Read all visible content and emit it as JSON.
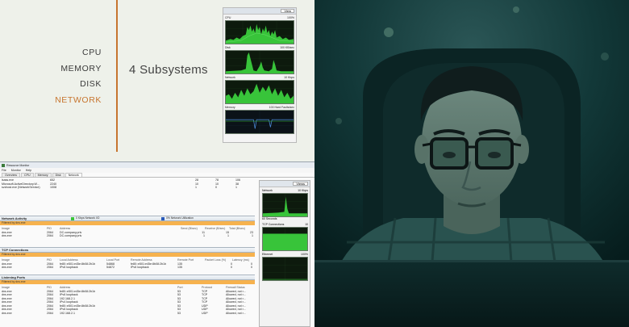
{
  "slide": {
    "subsystems": [
      "CPU",
      "MEMORY",
      "DISK",
      "NETWORK"
    ],
    "active_subsystem": "NETWORK",
    "title": "4 Subsystems",
    "accent_color": "#c7752f",
    "mini_panel": {
      "view_label": "View",
      "graphs": [
        {
          "name": "CPU",
          "value": "100%"
        },
        {
          "name": "Disk",
          "value": "100 KB/sec"
        },
        {
          "name": "Network",
          "value": "10 Kbps"
        },
        {
          "name": "Memory",
          "value": "100 Hard Faults/sec"
        }
      ]
    }
  },
  "resource_monitor": {
    "title": "Resource Monitor",
    "menu": [
      "File",
      "Monitor",
      "Help"
    ],
    "tabs": [
      "Overview",
      "CPU",
      "Memory",
      "Disk",
      "Network"
    ],
    "active_tab": "Network",
    "process_rows": [
      [
        "lsass.exe",
        "652",
        "28",
        "78",
        "106"
      ],
      [
        "Microsoft.ActiveDirectory.W...",
        "2240",
        "10",
        "10",
        "38"
      ],
      [
        "svchost.exe (NetworkService)",
        "1008",
        "1",
        "0",
        "1"
      ]
    ],
    "network_activity": {
      "title": "Network Activity",
      "legend_io": "0 Kbps Network I/O",
      "legend_util": "0% Network Utilization",
      "filter": "Filtered by dns.exe",
      "headers": [
        "Image",
        "PID",
        "Address",
        "Send (B/sec)",
        "Receive (B/sec)",
        "Total (B/sec)"
      ],
      "rows": [
        [
          "dns.exe",
          "2064",
          "DC.company.priv",
          "11",
          "15",
          "23"
        ],
        [
          "dns.exe",
          "2064",
          "DC.company.priv",
          "1",
          "1",
          "1"
        ]
      ]
    },
    "tcp": {
      "title": "TCP Connections",
      "filter": "Filtered by dns.exe",
      "headers": [
        "Image",
        "PID",
        "Local Address",
        "Local Port",
        "Remote Address",
        "Remote Port",
        "Packet Loss (%)",
        "Latency (ms)"
      ],
      "rows": [
        [
          "dns.exe",
          "2064",
          "fe80::e501:e45e:8b08:2b1b",
          "54868",
          "fe80::e501:e45e:8b08:2b1b",
          "135",
          "0",
          "0"
        ],
        [
          "dns.exe",
          "2064",
          "IPv6 loopback",
          "54872",
          "IPv6 loopback",
          "135",
          "0",
          "0"
        ]
      ]
    },
    "listening": {
      "title": "Listening Ports",
      "filter": "Filtered by dns.exe",
      "headers": [
        "Image",
        "PID",
        "Address",
        "Port",
        "Protocol",
        "Firewall Status"
      ],
      "rows": [
        [
          "dns.exe",
          "2064",
          "fe80::e501:e45e:8b08:2b1b",
          "53",
          "TCP",
          "Allowed, not r..."
        ],
        [
          "dns.exe",
          "2064",
          "IPv6 loopback",
          "53",
          "TCP",
          "Allowed, not r..."
        ],
        [
          "dns.exe",
          "2064",
          "192.168.2.1",
          "53",
          "TCP",
          "Allowed, not r..."
        ],
        [
          "dns.exe",
          "2064",
          "IPv4 loopback",
          "53",
          "TCP",
          "Allowed, not r..."
        ],
        [
          "dns.exe",
          "2064",
          "fe80::e501:e45e:8b08:2b1b",
          "53",
          "UDP",
          "Allowed, not r..."
        ],
        [
          "dns.exe",
          "2064",
          "IPv6 loopback",
          "53",
          "UDP",
          "Allowed, not r..."
        ],
        [
          "dns.exe",
          "2064",
          "192.168.2.1",
          "53",
          "UDP",
          "Allowed, not r..."
        ]
      ]
    },
    "side_panel": {
      "view_label": "Views",
      "graphs": [
        {
          "name": "Network",
          "value": "10 Kbps"
        },
        {
          "name": "TCP Connections",
          "value": "10"
        },
        {
          "name": "Ethernet",
          "value": "100%"
        }
      ],
      "interval_label": "60 Seconds"
    }
  }
}
